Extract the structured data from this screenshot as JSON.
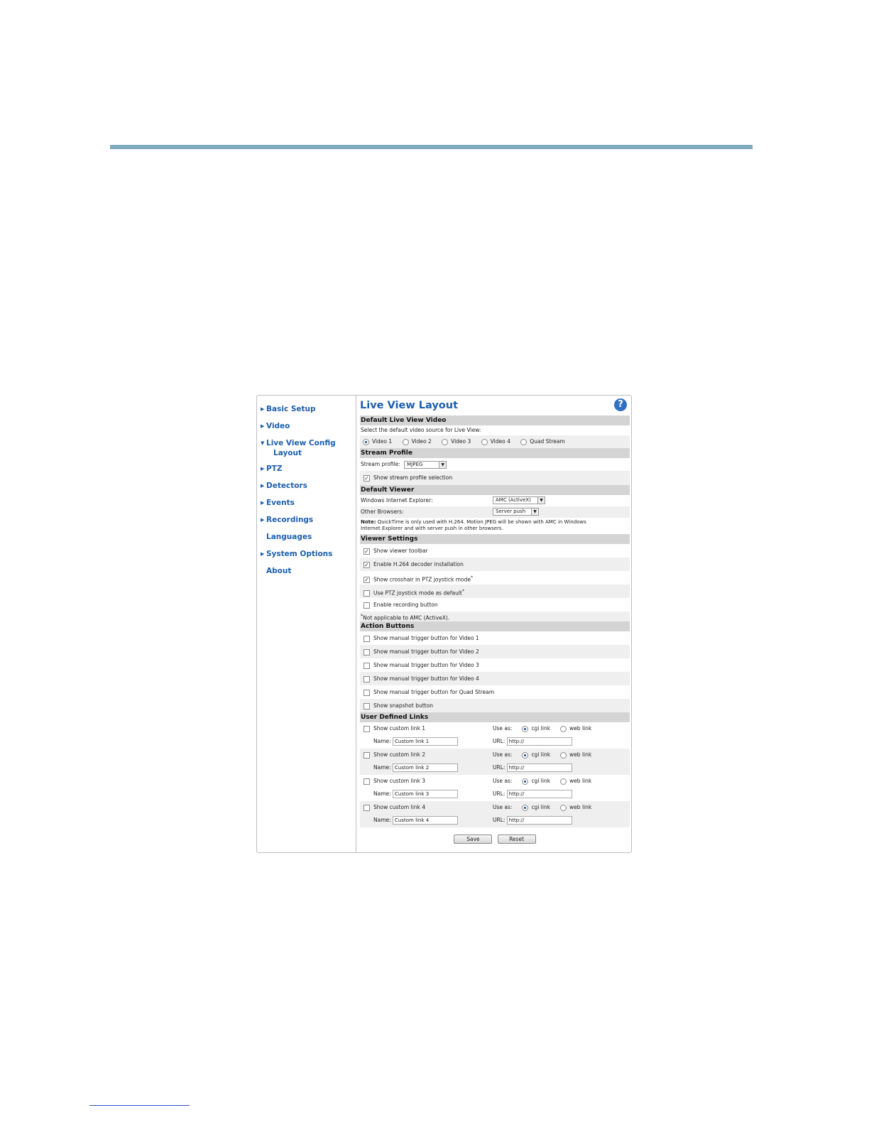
{
  "sidebar": {
    "items": [
      {
        "label": "Basic Setup",
        "arrow": true
      },
      {
        "label": "Video",
        "arrow": true
      },
      {
        "label": "Live View Config",
        "sub": "Layout",
        "arrow": true,
        "open": true
      },
      {
        "label": "PTZ",
        "arrow": true
      },
      {
        "label": "Detectors",
        "arrow": true
      },
      {
        "label": "Events",
        "arrow": true
      },
      {
        "label": "Recordings",
        "arrow": true
      },
      {
        "label": "Languages",
        "arrow": false
      },
      {
        "label": "System Options",
        "arrow": true
      },
      {
        "label": "About",
        "arrow": false
      }
    ]
  },
  "page": {
    "title": "Live View Layout",
    "help_icon": "?"
  },
  "default_video": {
    "header": "Default Live View Video",
    "instruction": "Select the default video source for Live View:",
    "options": [
      "Video 1",
      "Video 2",
      "Video 3",
      "Video 4",
      "Quad Stream"
    ],
    "selected": "Video 1"
  },
  "stream_profile": {
    "header": "Stream Profile",
    "label": "Stream profile:",
    "value": "MJPEG",
    "show_selection_label": "Show stream profile selection",
    "show_selection_checked": true
  },
  "default_viewer": {
    "header": "Default Viewer",
    "ie_label": "Windows Internet Explorer:",
    "ie_value": "AMC (ActiveX)",
    "other_label": "Other Browsers:",
    "other_value": "Server push",
    "note_bold": "Note:",
    "note_line1": "QuickTime is only used with H.264. Motion JPEG will be shown with AMC in Windows",
    "note_line2": "Internet Explorer and with server push in other browsers."
  },
  "viewer_settings": {
    "header": "Viewer Settings",
    "items": [
      {
        "label": "Show viewer toolbar",
        "checked": true,
        "star": false
      },
      {
        "label": "Enable H.264 decoder installation",
        "checked": true,
        "star": false
      },
      {
        "label": "Show crosshair in PTZ joystick mode",
        "checked": true,
        "star": true
      },
      {
        "label": "Use PTZ joystick mode as default",
        "checked": false,
        "star": true
      },
      {
        "label": "Enable recording button",
        "checked": false,
        "star": false
      }
    ],
    "footnote": "Not applicable to AMC (ActiveX).",
    "star": "*"
  },
  "action_buttons": {
    "header": "Action Buttons",
    "items": [
      "Show manual trigger button for Video 1",
      "Show manual trigger button for Video 2",
      "Show manual trigger button for Video 3",
      "Show manual trigger button for Video 4",
      "Show manual trigger button for Quad Stream",
      "Show snapshot button"
    ]
  },
  "user_links": {
    "header": "User Defined Links",
    "use_as": "Use as:",
    "cgi": "cgi link",
    "web": "web link",
    "name_label": "Name:",
    "url_label": "URL:",
    "links": [
      {
        "label": "Show custom link 1",
        "name": "Custom link 1",
        "url": "http://"
      },
      {
        "label": "Show custom link 2",
        "name": "Custom link 2",
        "url": "http://"
      },
      {
        "label": "Show custom link 3",
        "name": "Custom link 3",
        "url": "http://"
      },
      {
        "label": "Show custom link 4",
        "name": "Custom link 4",
        "url": "http://"
      }
    ]
  },
  "buttons": {
    "save": "Save",
    "reset": "Reset"
  }
}
